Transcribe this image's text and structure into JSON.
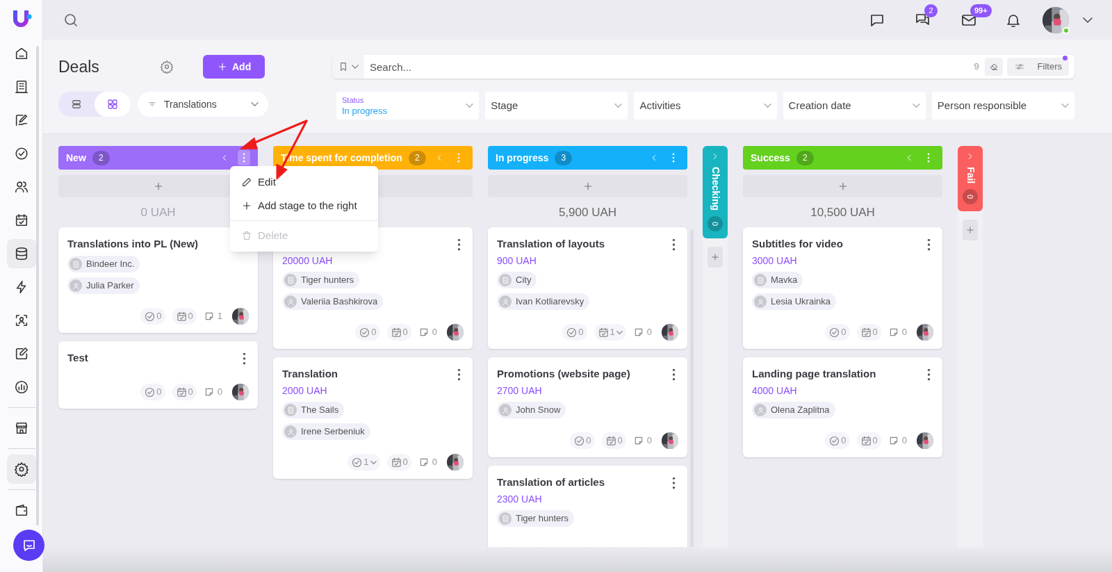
{
  "sidebar": {
    "groups": [
      [
        {
          "selected": false
        },
        {
          "selected": false
        },
        {
          "selected": false
        },
        {
          "selected": false
        },
        {
          "selected": false
        },
        {
          "selected": false
        },
        {
          "selected": true
        },
        {
          "selected": false
        },
        {
          "selected": false
        },
        {
          "selected": false
        },
        {
          "selected": false
        }
      ],
      [
        {
          "selected": false
        }
      ],
      [
        {
          "selected": true
        }
      ],
      [
        {
          "selected": false
        }
      ]
    ]
  },
  "topbar": {
    "chats_badge": "2",
    "mail_badge": "99+",
    "user_online": true
  },
  "page": {
    "title": "Deals",
    "add_button": "Add",
    "views": [
      {
        "selected": false
      },
      {
        "selected": true
      }
    ],
    "pipeline": "Translations"
  },
  "search": {
    "placeholder": "Search...",
    "count": "9",
    "filters_label": "Filters",
    "filters_active": true
  },
  "filters": [
    {
      "label": "Status",
      "value": "In progress"
    },
    {
      "placeholder": "Stage"
    },
    {
      "placeholder": "Activities"
    },
    {
      "placeholder": "Creation date"
    },
    {
      "placeholder": "Person responsible"
    }
  ],
  "stage_menu": {
    "items": [
      {
        "kind": "edit",
        "label": "Edit",
        "disabled": false
      },
      {
        "kind": "add",
        "label": "Add stage to the right",
        "disabled": false
      },
      {
        "kind": "delete",
        "label": "Delete",
        "disabled": true
      }
    ]
  },
  "stages": [
    {
      "name": "New",
      "count": "2",
      "color": "#9d6cf9",
      "collapsed": false,
      "menu_open": true,
      "total": "0 UAH",
      "total_muted": true,
      "cards": [
        {
          "title": "Translations into PL (New)",
          "chips": [
            {
              "kind": "company",
              "label": "Bindeer Inc."
            },
            {
              "kind": "person",
              "label": "Julia Parker"
            }
          ],
          "tasks": "0",
          "tasks_dropdown": false,
          "activities": "0",
          "activities_dropdown": false,
          "comments": "1"
        },
        {
          "title": "Test",
          "tasks": "0",
          "tasks_dropdown": false,
          "activities": "0",
          "activities_dropdown": false,
          "comments": "0"
        }
      ]
    },
    {
      "name": "Time spent for completion",
      "count": "2",
      "color": "#ffb108",
      "collapsed": false,
      "menu_open": false,
      "cards": [
        {
          "amount": "20000 UAH",
          "chips": [
            {
              "kind": "company",
              "label": "Tiger hunters"
            },
            {
              "kind": "person",
              "label": "Valeriia Bashkirova"
            }
          ],
          "tasks": "0",
          "tasks_dropdown": false,
          "activities": "0",
          "activities_dropdown": false,
          "comments": "0"
        },
        {
          "title": "Translation",
          "amount": "2000 UAH",
          "chips": [
            {
              "kind": "company",
              "label": "The Sails"
            },
            {
              "kind": "person",
              "label": "Irene Serbeniuk"
            }
          ],
          "tasks": "1",
          "tasks_dropdown": true,
          "activities": "0",
          "activities_dropdown": false,
          "comments": "0"
        }
      ]
    },
    {
      "name": "In progress",
      "count": "3",
      "color": "#14b1fa",
      "collapsed": false,
      "menu_open": false,
      "total": "5,900 UAH",
      "total_muted": false,
      "cards": [
        {
          "title": "Translation of layouts",
          "amount": "900 UAH",
          "chips": [
            {
              "kind": "company",
              "label": "City"
            },
            {
              "kind": "person",
              "label": "Ivan Kotliarevsky"
            }
          ],
          "tasks": "0",
          "tasks_dropdown": false,
          "activities": "1",
          "activities_dropdown": true,
          "comments": "0"
        },
        {
          "title": "Promotions (website page)",
          "amount": "2700 UAH",
          "chips": [
            {
              "kind": "person",
              "label": "John Snow"
            }
          ],
          "tasks": "0",
          "tasks_dropdown": false,
          "activities": "0",
          "activities_dropdown": false,
          "comments": "0"
        },
        {
          "title": "Translation of articles",
          "amount": "2300 UAH",
          "chips": [
            {
              "kind": "company",
              "label": "Tiger hunters"
            }
          ]
        }
      ]
    },
    {
      "name": "Checking",
      "count": "0",
      "color": "#18b4c0",
      "collapsed": true
    },
    {
      "name": "Success",
      "count": "2",
      "color": "#64d11f",
      "collapsed": false,
      "menu_open": false,
      "total": "10,500 UAH",
      "total_muted": false,
      "cards": [
        {
          "title": "Subtitles for video",
          "amount": "3000 UAH",
          "chips": [
            {
              "kind": "company",
              "label": "Mavka"
            },
            {
              "kind": "person",
              "label": "Lesia Ukrainka"
            }
          ],
          "tasks": "0",
          "tasks_dropdown": false,
          "activities": "0",
          "activities_dropdown": false,
          "comments": "0"
        },
        {
          "title": "Landing page translation",
          "amount": "4000 UAH",
          "chips": [
            {
              "kind": "person",
              "label": "Olena Zaplitna"
            }
          ],
          "tasks": "0",
          "tasks_dropdown": false,
          "activities": "0",
          "activities_dropdown": false,
          "comments": "0"
        }
      ]
    },
    {
      "name": "Fail",
      "count": "0",
      "color": "#fb5e5e",
      "collapsed": true
    }
  ]
}
